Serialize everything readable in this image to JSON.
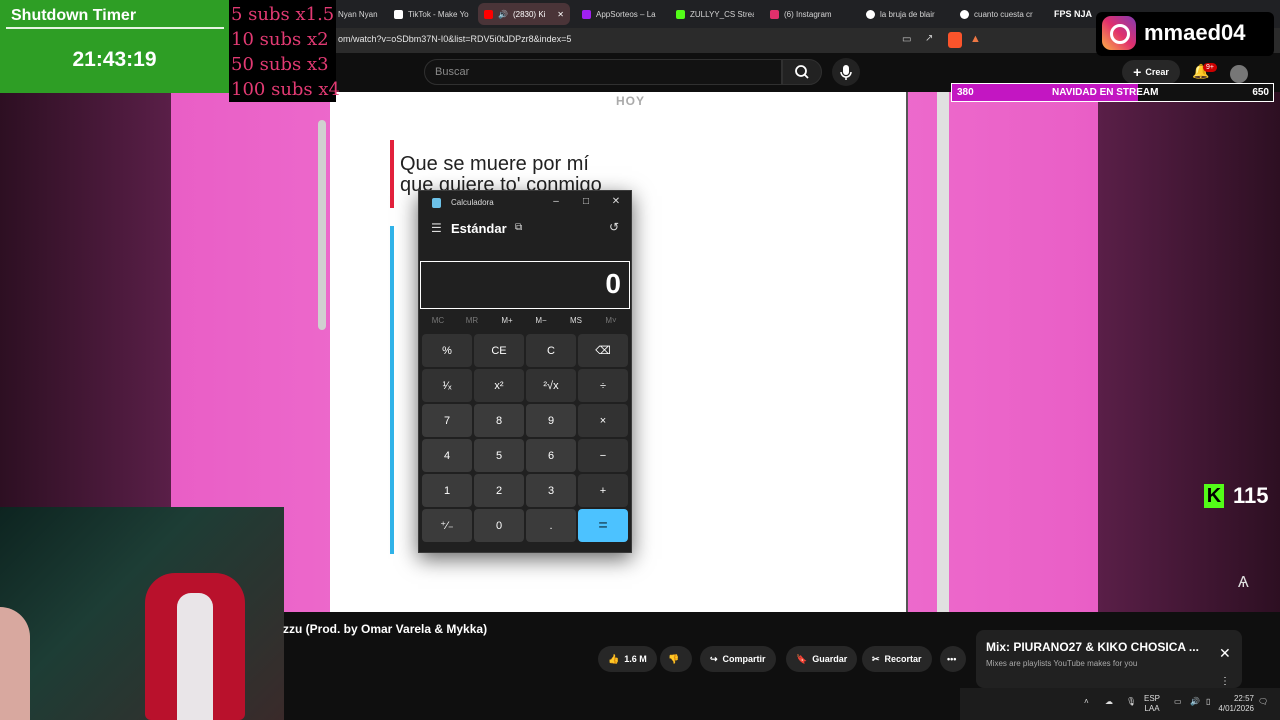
{
  "browser": {
    "tabs": [
      {
        "label": "Nyan Nyan",
        "color": "#888888"
      },
      {
        "label": "TikTok - Make Yo",
        "color": "#ffffff"
      },
      {
        "label": "(2830) Ki",
        "color": "#ff0000"
      },
      {
        "label": "AppSorteos – La",
        "color": "#a020f0"
      },
      {
        "label": "ZULLYY_CS Strea",
        "color": "#53fc18"
      },
      {
        "label": "(6) Instagram",
        "color": "#e1306c"
      },
      {
        "label": "la bruja de blair",
        "color": "#ffffff"
      },
      {
        "label": "cuanto cuesta cr",
        "color": "#ffffff"
      }
    ],
    "url": "om/watch?v=oSDbm37N-I0&list=RDV5i0tJDPzr8&index=5"
  },
  "youtube": {
    "search_placeholder": "Buscar",
    "create_label": "Crear",
    "notif_badge": "9+",
    "video_title": "zzu (Prod. by Omar Varela & Mykka)",
    "likes": "1.6 M",
    "share": "Compartir",
    "save": "Guardar",
    "clip": "Recortar",
    "mix_title": "Mix: PIURANO27 & KIKO CHOSICA ...",
    "mix_sub": "Mixes are playlists YouTube makes for you"
  },
  "video": {
    "hoy": "HOY",
    "lyric_line1": "Que se muere por mí",
    "lyric_line2": "que quiere to' conmigo"
  },
  "calculator": {
    "title": "Calculadora",
    "mode": "Estándar",
    "display": "0",
    "memory": [
      "MC",
      "MR",
      "M+",
      "M−",
      "MS",
      "M˅"
    ],
    "keys": [
      [
        "%",
        "CE",
        "C",
        "⌫"
      ],
      [
        "¹⁄ₓ",
        "x²",
        "²√x",
        "÷"
      ],
      [
        "7",
        "8",
        "9",
        "×"
      ],
      [
        "4",
        "5",
        "6",
        "−"
      ],
      [
        "1",
        "2",
        "3",
        "+"
      ],
      [
        "⁺⁄₋",
        "0",
        ".",
        "="
      ]
    ]
  },
  "overlays": {
    "timer_title": "Shutdown Timer",
    "timer_value": "21:43:19",
    "subs_lines": [
      "5 subs x1.5",
      "10 subs x2",
      "50 subs x3",
      "100 subs x4"
    ],
    "ig_name": "mmaed04",
    "goal_left": "380",
    "goal_title": "NAVIDAD EN STREAM",
    "goal_right": "650",
    "goal_progress": 0.58,
    "kick_count": "115",
    "fps_label": "FPS NJA"
  },
  "taskbar": {
    "lang1": "ESP",
    "lang2": "LAA",
    "time": "22:57",
    "date": "4/01/2026"
  }
}
